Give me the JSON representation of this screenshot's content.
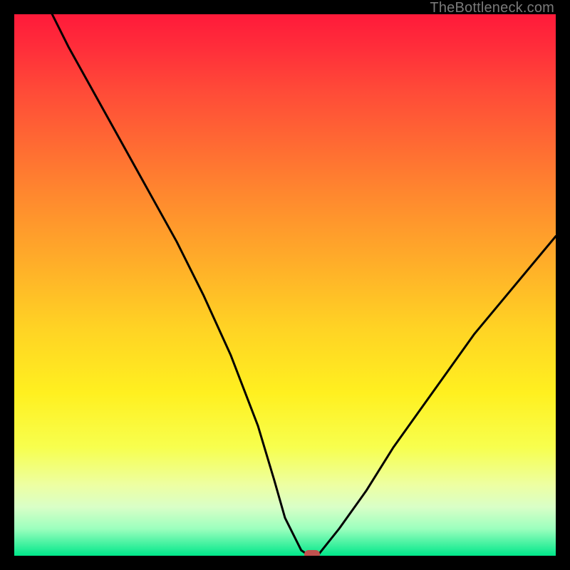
{
  "attribution": "TheBottleneck.com",
  "chart_data": {
    "type": "line",
    "title": "",
    "xlabel": "",
    "ylabel": "",
    "xlim": [
      0,
      100
    ],
    "ylim": [
      0,
      100
    ],
    "x": [
      7,
      10,
      15,
      20,
      25,
      30,
      35,
      40,
      45,
      48,
      50,
      53,
      54.5,
      56,
      60,
      65,
      70,
      75,
      80,
      85,
      90,
      95,
      100
    ],
    "values": [
      100,
      94,
      85,
      76,
      67,
      58,
      48,
      37,
      24,
      14,
      7,
      1,
      0,
      0,
      5,
      12,
      20,
      27,
      34,
      41,
      47,
      53,
      59
    ],
    "marker": {
      "x": 55,
      "y": 0.2
    },
    "colors": {
      "gradient_top": "#ff1a3a",
      "gradient_bottom": "#00e78a",
      "curve": "#000000",
      "marker": "#c1524f",
      "frame": "#000000"
    }
  }
}
